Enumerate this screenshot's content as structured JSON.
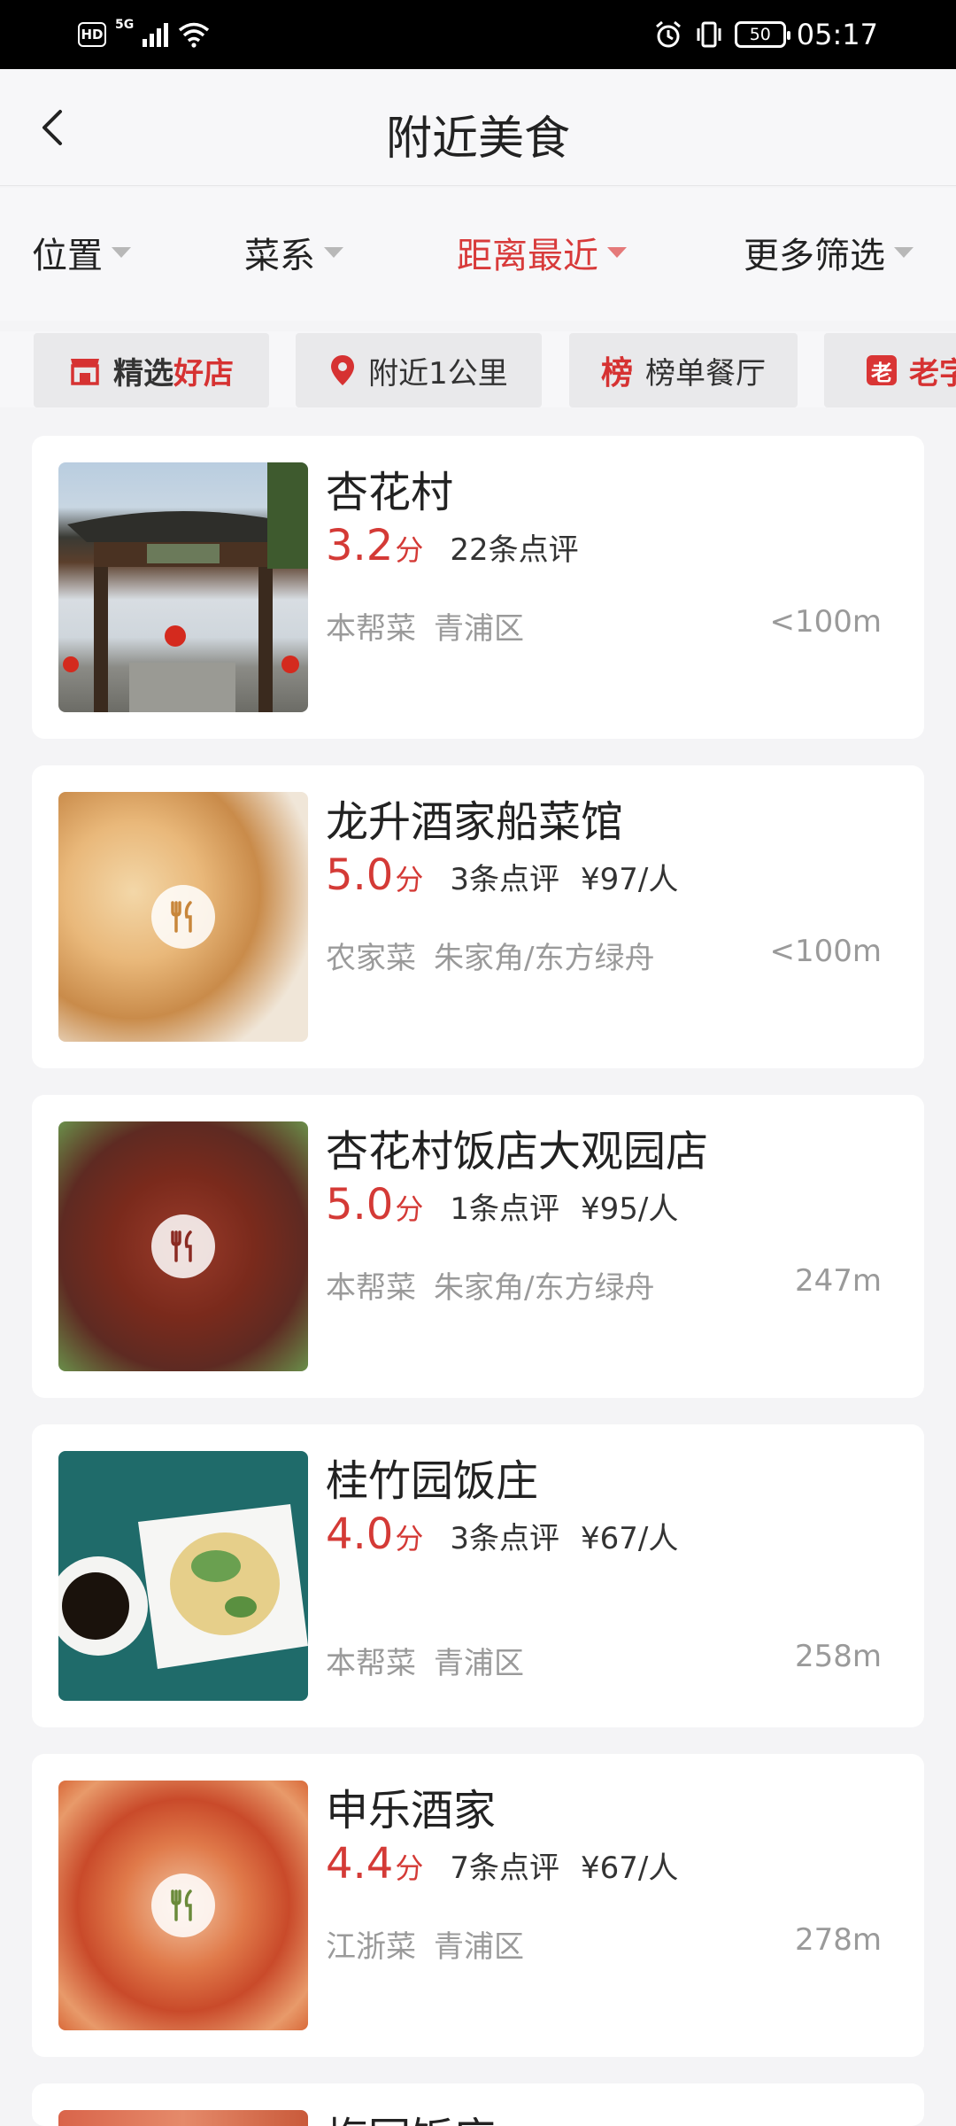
{
  "status_bar": {
    "hd": "HD",
    "network": "5G",
    "battery": "50",
    "time": "05:17"
  },
  "nav": {
    "title": "附近美食"
  },
  "filters": [
    {
      "label": "位置",
      "active": false
    },
    {
      "label": "菜系",
      "active": false
    },
    {
      "label": "距离最近",
      "active": true
    },
    {
      "label": "更多筛选",
      "active": false
    }
  ],
  "chips": [
    {
      "label_a": "精选",
      "label_b": "好店",
      "icon": "store-icon"
    },
    {
      "label": "附近1公里",
      "icon": "location-pin-icon"
    },
    {
      "badge": "榜",
      "label": "榜单餐厅",
      "icon": "ranking-icon"
    },
    {
      "badge": "老",
      "label": "老字",
      "icon": "old-brand-icon"
    }
  ],
  "restaurants": [
    {
      "name": "杏花村",
      "score": "3.2",
      "score_unit": "分",
      "reviews": "22条点评",
      "price": "",
      "cuisine": "本帮菜",
      "area": "青浦区",
      "distance": "<100m",
      "photo": "gate-photo"
    },
    {
      "name": "龙升酒家船菜馆",
      "score": "5.0",
      "score_unit": "分",
      "reviews": "3条点评",
      "price": "¥97/人",
      "cuisine": "农家菜",
      "area": "朱家角/东方绿舟",
      "distance": "<100m",
      "photo": "blurred-food-photo"
    },
    {
      "name": "杏花村饭店大观园店",
      "score": "5.0",
      "score_unit": "分",
      "reviews": "1条点评",
      "price": "¥95/人",
      "cuisine": "本帮菜",
      "area": "朱家角/东方绿舟",
      "distance": "247m",
      "photo": "blurred-food-photo"
    },
    {
      "name": "桂竹园饭庄",
      "score": "4.0",
      "score_unit": "分",
      "reviews": "3条点评",
      "price": "¥67/人",
      "cuisine": "本帮菜",
      "area": "青浦区",
      "distance": "258m",
      "photo": "chicken-dish-photo"
    },
    {
      "name": "申乐酒家",
      "score": "4.4",
      "score_unit": "分",
      "reviews": "7条点评",
      "price": "¥67/人",
      "cuisine": "江浙菜",
      "area": "青浦区",
      "distance": "278m",
      "photo": "blurred-food-photo"
    },
    {
      "name": "梅园饭店",
      "photo": "partial-photo"
    }
  ]
}
